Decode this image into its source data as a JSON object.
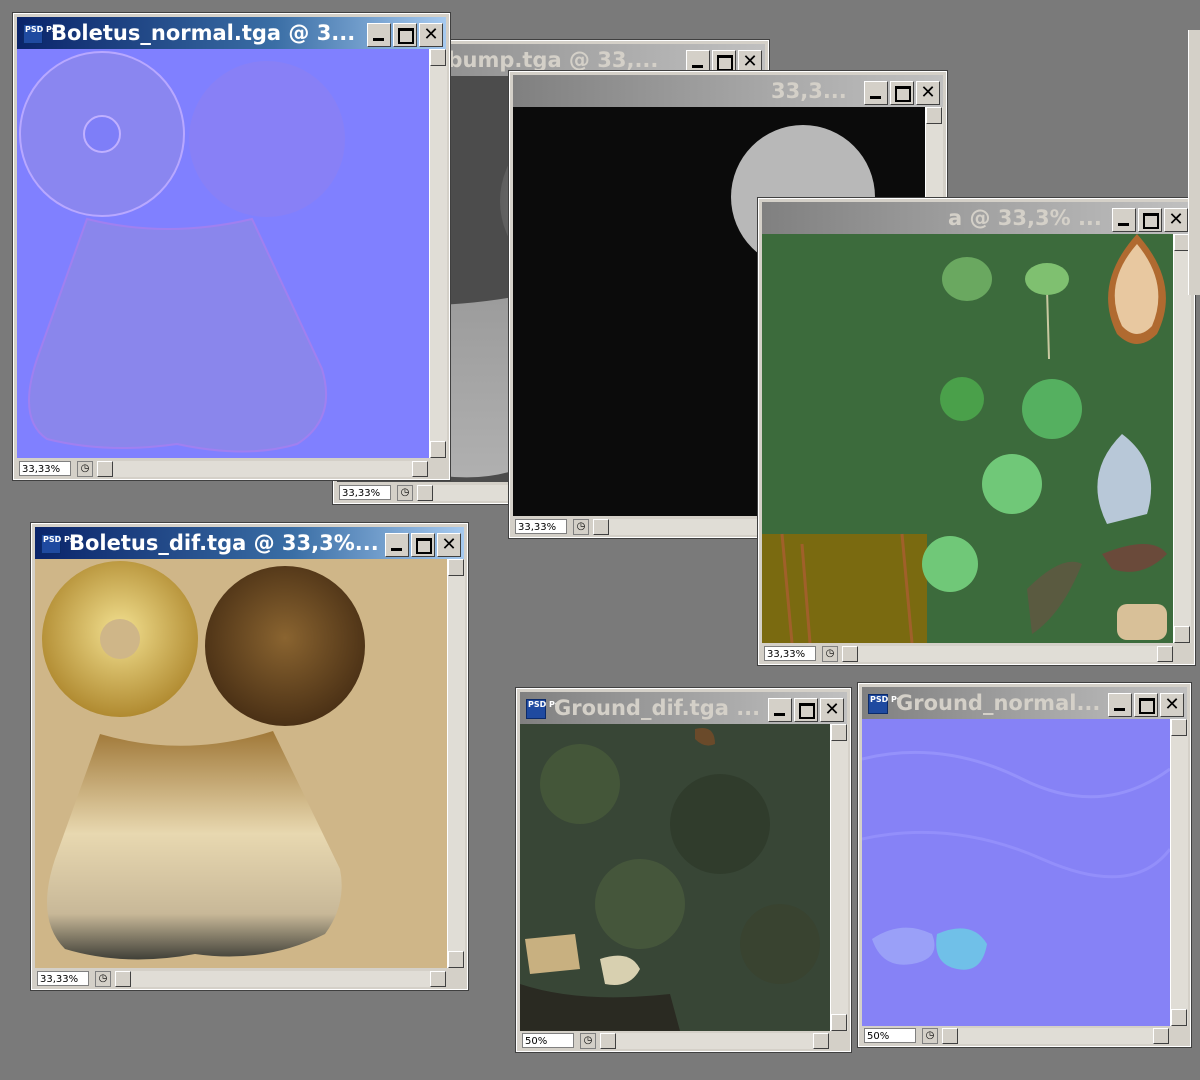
{
  "windows": {
    "boletus_normal": {
      "title": "Boletus_normal.tga @ 3...",
      "zoom": "33,33%"
    },
    "boletus_bump": {
      "title": "_bump.tga @ 33,...",
      "zoom": "33,33%"
    },
    "boletus_third": {
      "title": "33,3...",
      "zoom": "33,33%"
    },
    "plants": {
      "title": "a @ 33,3% ...",
      "zoom": "33,33%"
    },
    "boletus_dif": {
      "title": "Boletus_dif.tga @ 33,3%...",
      "zoom": "33,33%"
    },
    "ground_dif": {
      "title": "Ground_dif.tga ...",
      "zoom": "50%"
    },
    "ground_normal": {
      "title": "Ground_normal...",
      "zoom": "50%"
    }
  },
  "icon": {
    "ps_label": "PSD Ps"
  },
  "colors": {
    "desktop": "#7a7a7a",
    "normal_map": "#8080ff",
    "bump_bg": "#4c4c4c",
    "spec_bg": "#0b0b0b",
    "plants_bg": "#3c6b3c",
    "dif_bg": "#cfb688"
  }
}
